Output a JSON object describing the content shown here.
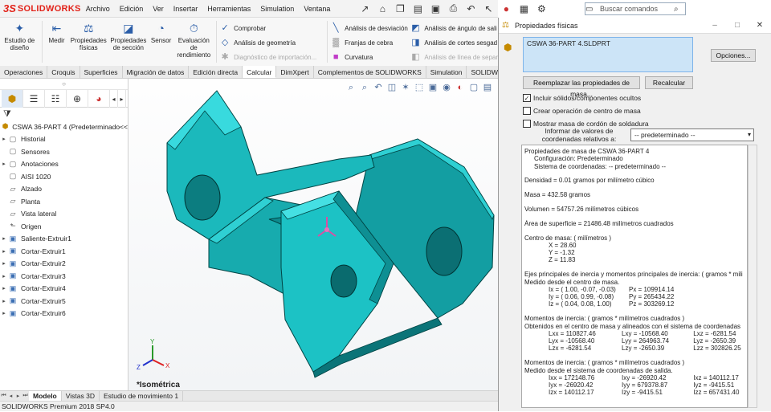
{
  "app": {
    "logo_prefix": "3S",
    "logo_name": "SOLIDWORKS",
    "status": "SOLIDWORKS Premium 2018 SP4.0"
  },
  "menu": [
    "Archivo",
    "Edición",
    "Ver",
    "Insertar",
    "Herramientas",
    "Simulation",
    "Ventana"
  ],
  "search": {
    "placeholder": "Buscar comandos"
  },
  "toolbar": {
    "big": [
      {
        "icon": "design-study-icon",
        "label": "Estudio de diseño"
      },
      {
        "icon": "measure-icon",
        "label": "Medir"
      },
      {
        "icon": "mass-properties-icon",
        "label": "Propiedades físicas"
      },
      {
        "icon": "section-properties-icon",
        "label": "Propiedades de sección"
      },
      {
        "icon": "sensor-icon",
        "label": "Sensor"
      },
      {
        "icon": "performance-eval-icon",
        "label": "Evaluación de rendimiento"
      }
    ],
    "col1": [
      {
        "label": "Comprobar",
        "disabled": false
      },
      {
        "label": "Análisis de geometría",
        "disabled": false
      },
      {
        "label": "Diagnóstico de importación...",
        "disabled": true
      }
    ],
    "col2": [
      {
        "label": "Análisis de desviación",
        "disabled": false
      },
      {
        "label": "Franjas de cebra",
        "disabled": false
      },
      {
        "label": "Curvatura",
        "disabled": false
      }
    ],
    "col3": [
      {
        "label": "Análisis de ángulo de sali",
        "disabled": false
      },
      {
        "label": "Análisis de cortes sesgad",
        "disabled": false
      },
      {
        "label": "Análisis de línea de separ",
        "disabled": true
      }
    ]
  },
  "tabs": [
    "Operaciones",
    "Croquis",
    "Superficies",
    "Migración de datos",
    "Edición directa",
    "Calcular",
    "DimXpert",
    "Complementos de SOLIDWORKS",
    "Simulation",
    "SOLIDWOR"
  ],
  "active_tab": "Calcular",
  "tree": {
    "root": "CSWA 36-PART 4  (Predeterminado<<",
    "items": [
      {
        "label": "Historial",
        "expand": "▸",
        "icon": "history-icon"
      },
      {
        "label": "Sensores",
        "expand": "",
        "icon": "sensor-folder-icon"
      },
      {
        "label": "Anotaciones",
        "expand": "▸",
        "icon": "annotations-icon"
      },
      {
        "label": "AISI 1020",
        "expand": "",
        "icon": "material-icon"
      },
      {
        "label": "Alzado",
        "expand": "",
        "icon": "plane-icon"
      },
      {
        "label": "Planta",
        "expand": "",
        "icon": "plane-icon"
      },
      {
        "label": "Vista lateral",
        "expand": "",
        "icon": "plane-icon"
      },
      {
        "label": "Origen",
        "expand": "",
        "icon": "origin-icon"
      },
      {
        "label": "Saliente-Extruir1",
        "expand": "▸",
        "icon": "extrude-icon"
      },
      {
        "label": "Cortar-Extruir1",
        "expand": "▸",
        "icon": "cut-extrude-icon"
      },
      {
        "label": "Cortar-Extruir2",
        "expand": "▸",
        "icon": "cut-extrude-icon"
      },
      {
        "label": "Cortar-Extruir3",
        "expand": "▸",
        "icon": "cut-extrude-icon"
      },
      {
        "label": "Cortar-Extruir4",
        "expand": "▸",
        "icon": "cut-extrude-icon"
      },
      {
        "label": "Cortar-Extruir5",
        "expand": "▸",
        "icon": "cut-extrude-icon"
      },
      {
        "label": "Cortar-Extruir6",
        "expand": "▸",
        "icon": "cut-extrude-icon"
      }
    ]
  },
  "viewport": {
    "view_label": "*Isométrica",
    "axis_x": "X",
    "axis_y": "Y",
    "axis_z": "Z",
    "model_color": "#1ab5b8"
  },
  "bottom_tabs": [
    "Modelo",
    "Vistas 3D",
    "Estudio de movimiento 1"
  ],
  "active_bottom": "Modelo",
  "dialog": {
    "title": "Propiedades físicas",
    "file": "CSWA 36-PART 4.SLDPRT",
    "options_button": "Opciones...",
    "override_button": "Reemplazar las propiedades de masa...",
    "recalc_button": "Recalcular",
    "check_hidden": "Incluir sólidos/componentes ocultos",
    "check_com": "Crear operación de centro de masa",
    "check_weld": "Mostrar masa de cordón de soldadura",
    "coord_label": "Informar de valores de coordenadas relativos a:",
    "coord_value": "-- predeterminado --",
    "results": {
      "title": "Propiedades de masa de CSWA 36-PART 4",
      "config": "Configuración:  Predeterminado",
      "coord_sys": "Sistema de coordenadas:  -- predeterminado --",
      "density": "Densidad = 0.01 gramos por milímetro cúbico",
      "mass": "Masa = 432.58 gramos",
      "volume": "Volumen = 54757.26 milímetros cúbicos",
      "area": "Área de superficie = 21486.48  milímetros cuadrados",
      "com_title": "Centro de masa: ( milímetros )",
      "com_x": "X = 28.60",
      "com_y": "Y = -1.32",
      "com_z": "Z = 11.83",
      "axes_title": "Ejes principales de inercia y momentos principales de inercia: ( gramos *  mili",
      "axes_sub": "Medido desde el centro de masa.",
      "axes": [
        [
          "Ix = ( 1.00, -0.07, -0.03)",
          "Px = 109914.14"
        ],
        [
          "Iy = ( 0.06,  0.99, -0.08)",
          "Py = 265434.22"
        ],
        [
          "Iz = ( 0.04,  0.08,  1.00)",
          "Pz = 303269.12"
        ]
      ],
      "moi1_title": "Momentos de inercia: ( gramos *  milímetros cuadrados )",
      "moi1_sub": "Obtenidos en el centro de masa y alineados con el sistema de coordenadas",
      "moi1": [
        [
          "Lxx = 110827.46",
          "Lxy = -10568.40",
          "Lxz = -6281.54"
        ],
        [
          "Lyx = -10568.40",
          "Lyy = 264963.74",
          "Lyz = -2650.39"
        ],
        [
          "Lzx = -6281.54",
          "Lzy = -2650.39",
          "Lzz = 302826.25"
        ]
      ],
      "moi2_title": "Momentos de inercia: ( gramos *  milímetros cuadrados )",
      "moi2_sub": "Medido desde el sistema de coordenadas de salida.",
      "moi2": [
        [
          "Ixx = 172148.76",
          "Ixy = -26920.42",
          "Ixz = 140112.17"
        ],
        [
          "Iyx = -26920.42",
          "Iyy = 679378.87",
          "Iyz = -9415.51"
        ],
        [
          "Izx = 140112.17",
          "Izy = -9415.51",
          "Izz = 657431.40"
        ]
      ]
    }
  }
}
